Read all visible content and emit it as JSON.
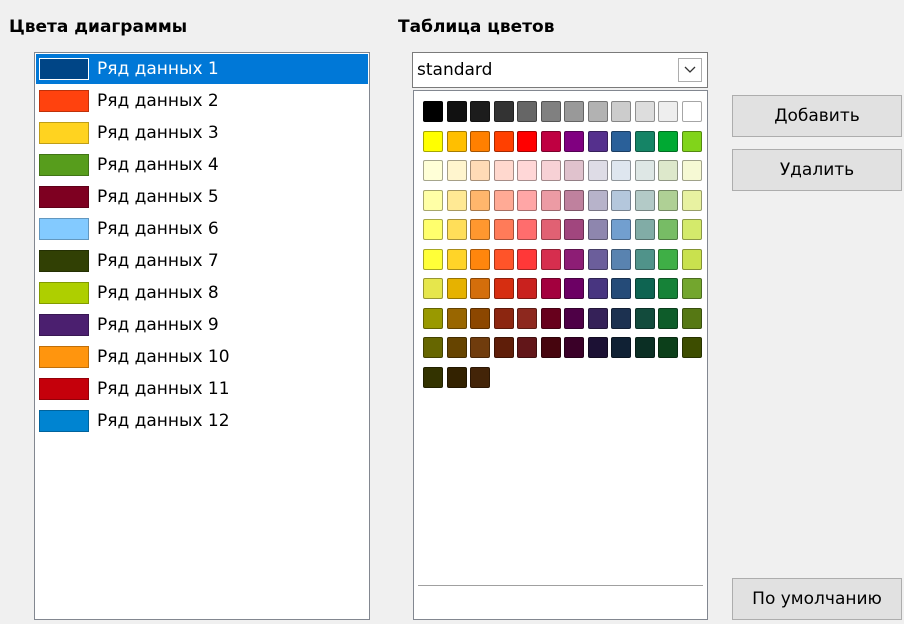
{
  "left_title": "Цвета диаграммы",
  "right_title": "Таблица цветов",
  "series": [
    {
      "label": "Ряд данных 1",
      "color": "#004586",
      "selected": true
    },
    {
      "label": "Ряд данных 2",
      "color": "#ff420e",
      "selected": false
    },
    {
      "label": "Ряд данных 3",
      "color": "#ffd320",
      "selected": false
    },
    {
      "label": "Ряд данных 4",
      "color": "#579d1c",
      "selected": false
    },
    {
      "label": "Ряд данных 5",
      "color": "#7e0021",
      "selected": false
    },
    {
      "label": "Ряд данных 6",
      "color": "#83caff",
      "selected": false
    },
    {
      "label": "Ряд данных 7",
      "color": "#314004",
      "selected": false
    },
    {
      "label": "Ряд данных 8",
      "color": "#aecf00",
      "selected": false
    },
    {
      "label": "Ряд данных 9",
      "color": "#4b1f6f",
      "selected": false
    },
    {
      "label": "Ряд данных 10",
      "color": "#ff950e",
      "selected": false
    },
    {
      "label": "Ряд данных 11",
      "color": "#c5000b",
      "selected": false
    },
    {
      "label": "Ряд данных 12",
      "color": "#0084d1",
      "selected": false
    }
  ],
  "palette": {
    "selected": "standard",
    "dropdown_icon": "chevron-down-icon",
    "rows": [
      [
        "#000000",
        "#111111",
        "#1c1c1c",
        "#333333",
        "#666666",
        "#808080",
        "#999999",
        "#b2b2b2",
        "#cccccc",
        "#dddddd",
        "#eeeeee",
        "#ffffff"
      ],
      [
        "#ffff00",
        "#ffbf00",
        "#ff8000",
        "#ff4000",
        "#ff0000",
        "#bf0041",
        "#800080",
        "#55308d",
        "#2a6099",
        "#158466",
        "#00a933",
        "#81d41a"
      ],
      [
        "#ffffd7",
        "#fff5ce",
        "#ffdbb6",
        "#ffd8ce",
        "#ffd7d7",
        "#f7d1d5",
        "#e0c2cd",
        "#dedce6",
        "#dee6ef",
        "#dee7e5",
        "#dde8cb",
        "#f6f9d4"
      ],
      [
        "#ffffa6",
        "#ffe994",
        "#ffb66c",
        "#ffaa95",
        "#ffa6a6",
        "#ec9ba4",
        "#bf819e",
        "#b7b3ca",
        "#b4c7dc",
        "#b3cac7",
        "#afd095",
        "#e8f2a1"
      ],
      [
        "#ffff6d",
        "#ffde59",
        "#ff972f",
        "#ff7b59",
        "#ff6d6d",
        "#e16173",
        "#a1467e",
        "#8e86ae",
        "#729fcf",
        "#81aca6",
        "#77bc65",
        "#d4ea6b"
      ],
      [
        "#ffff38",
        "#ffd428",
        "#ff860d",
        "#ff5429",
        "#ff3838",
        "#d62e4e",
        "#8d1d75",
        "#6b5e9b",
        "#5983b0",
        "#50938a",
        "#3faf46",
        "#c9e14e"
      ],
      [
        "#e6e64c",
        "#e6b200",
        "#d46e0b",
        "#d62e11",
        "#c9211e",
        "#a3003e",
        "#6c0064",
        "#483580",
        "#254b78",
        "#0e6451",
        "#168238",
        "#73a62e"
      ],
      [
        "#999900",
        "#996600",
        "#8c4700",
        "#8c2610",
        "#8d281e",
        "#67001c",
        "#4e0046",
        "#352158",
        "#1c3150",
        "#124b3c",
        "#0e5c2a",
        "#567814"
      ],
      [
        "#666600",
        "#664400",
        "#703c0d",
        "#5f1e09",
        "#621619",
        "#46050e",
        "#3a0028",
        "#1c1134",
        "#102134",
        "#0b2f24",
        "#0c3f1a",
        "#3d4d00"
      ],
      [
        "#333300",
        "#332200",
        "#432408"
      ]
    ]
  },
  "buttons": {
    "add": "Добавить",
    "delete": "Удалить",
    "default": "По умолчанию"
  }
}
